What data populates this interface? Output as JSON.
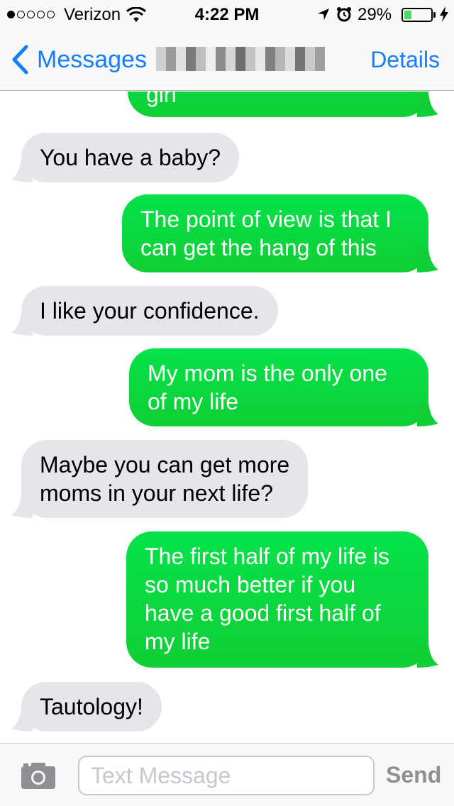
{
  "status_bar": {
    "signal_bars_filled": 1,
    "signal_bars_total": 5,
    "carrier": "Verizon",
    "time": "4:22 PM",
    "battery_percent_text": "29%",
    "battery_level": 0.29,
    "battery_color": "#4cd964"
  },
  "nav": {
    "back_label": "Messages",
    "details_label": "Details"
  },
  "messages": [
    {
      "direction": "sent",
      "lines": [
        "girl"
      ]
    },
    {
      "direction": "received",
      "lines": [
        "You have a baby?"
      ]
    },
    {
      "direction": "sent",
      "lines": [
        "The point of view is that I",
        "can get the hang of this"
      ]
    },
    {
      "direction": "received",
      "lines": [
        "I like your confidence."
      ]
    },
    {
      "direction": "sent",
      "lines": [
        "My mom is the only one",
        "of my life"
      ]
    },
    {
      "direction": "received",
      "lines": [
        "Maybe you can get more",
        "moms in your next life?"
      ]
    },
    {
      "direction": "sent",
      "lines": [
        "The first half of my life is",
        "so much better if you",
        "have a good first half of",
        "my life"
      ]
    },
    {
      "direction": "received",
      "lines": [
        "Tautology!"
      ]
    }
  ],
  "input": {
    "placeholder": "Text Message",
    "send_label": "Send"
  },
  "colors": {
    "sent_bubble": "#0ade3c",
    "received_bubble": "#e5e5ea",
    "accent": "#147efb"
  }
}
